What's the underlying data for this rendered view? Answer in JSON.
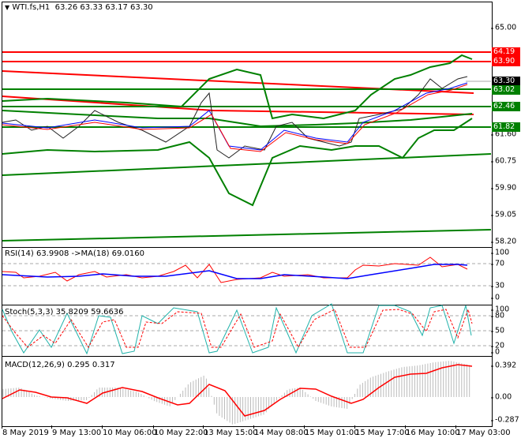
{
  "header": {
    "symbol": "WTI.fs,H1",
    "ohlc": "63.26 63.33 63.17 63.30",
    "menu_icon": "triangle-down-icon"
  },
  "price_axis": {
    "ticks": [
      "65.00",
      "61.60",
      "60.75",
      "59.90",
      "59.05",
      "58.20"
    ]
  },
  "levels": [
    {
      "label": "64.19",
      "color": "#ff0000"
    },
    {
      "label": "63.90",
      "color": "#ff0000"
    },
    {
      "label": "63.30",
      "color": "#000000"
    },
    {
      "label": "63.02",
      "color": "#008000"
    },
    {
      "label": "62.46",
      "color": "#008000"
    },
    {
      "label": "61.82",
      "color": "#008000"
    }
  ],
  "rsi": {
    "title": "RSI(14) 63.9908  ->MA(18) 69.0160",
    "ticks": [
      "100",
      "70",
      "30",
      "0"
    ]
  },
  "stoch": {
    "title": "Stoch(5,3,3) 35.8209 59.6636",
    "ticks": [
      "100",
      "80",
      "50",
      "20",
      "0"
    ]
  },
  "macd": {
    "title": "MACD(12,26,9) 0.295 0.317",
    "ticks": [
      "0.392",
      "0.00",
      "-0.287"
    ]
  },
  "time_axis": [
    "8 May 2019",
    "9 May 13:00",
    "10 May 06:00",
    "10 May 22:00",
    "13 May 15:00",
    "14 May 08:00",
    "15 May 01:00",
    "15 May 17:00",
    "16 May 10:00",
    "17 May 03:00"
  ]
}
